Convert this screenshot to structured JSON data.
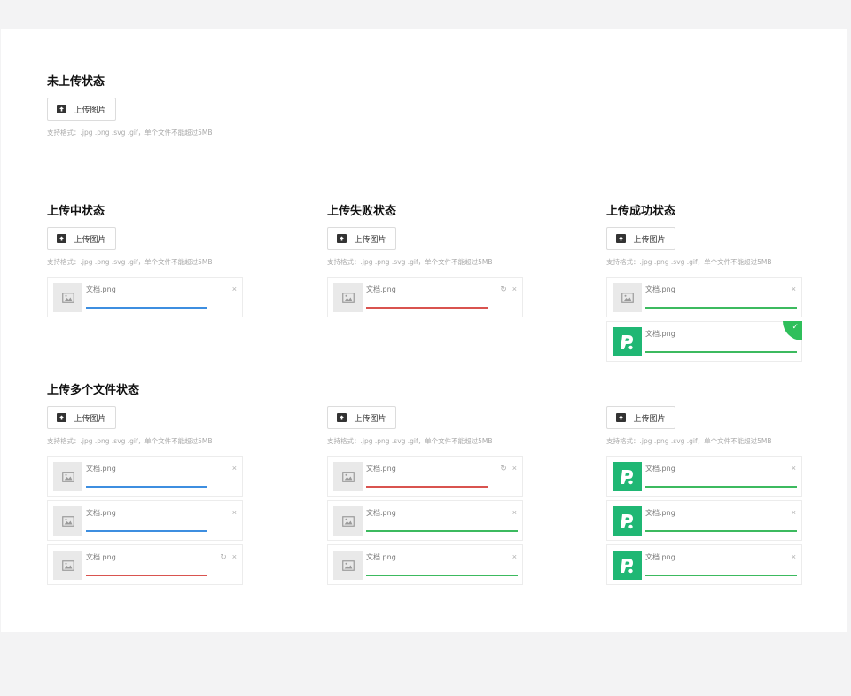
{
  "button_label": "上传图片",
  "hint_text": "支持格式：.jpg .png .svg .gif，单个文件不能超过5MB",
  "colors": {
    "uploading": "#3d8ee0",
    "failed": "#d9534f",
    "success": "#3cba5f",
    "logo_bg": "#1fb774"
  },
  "icons": {
    "upload": "upload-folder-icon",
    "image_placeholder": "image-placeholder-icon",
    "logo": "app-logo-icon",
    "close": "close-icon",
    "retry": "retry-icon",
    "check": "check-icon"
  },
  "glyphs": {
    "close": "×",
    "retry": "↻",
    "check": "✓"
  },
  "sections": {
    "not_uploaded": {
      "title": "未上传状态"
    },
    "uploading": {
      "title": "上传中状态",
      "files": [
        {
          "name": "文档.png",
          "progress": 0.8,
          "state": "uploading",
          "thumb": "placeholder",
          "actions": [
            "close"
          ]
        }
      ]
    },
    "failed": {
      "title": "上传失败状态",
      "files": [
        {
          "name": "文档.png",
          "progress": 0.8,
          "state": "failed",
          "thumb": "placeholder",
          "actions": [
            "retry",
            "close"
          ]
        }
      ]
    },
    "success": {
      "title": "上传成功状态",
      "files": [
        {
          "name": "文档.png",
          "progress": 1.0,
          "state": "success",
          "thumb": "placeholder",
          "actions": [
            "close"
          ]
        },
        {
          "name": "文档.png",
          "progress": 1.0,
          "state": "success",
          "thumb": "logo",
          "actions": [],
          "checked": true
        }
      ]
    },
    "multi": {
      "title": "上传多个文件状态",
      "columns": [
        [
          {
            "name": "文档.png",
            "progress": 0.8,
            "state": "uploading",
            "thumb": "placeholder",
            "actions": [
              "close"
            ]
          },
          {
            "name": "文档.png",
            "progress": 0.8,
            "state": "uploading",
            "thumb": "placeholder",
            "actions": [
              "close"
            ]
          },
          {
            "name": "文档.png",
            "progress": 0.8,
            "state": "failed",
            "thumb": "placeholder",
            "actions": [
              "retry",
              "close"
            ]
          }
        ],
        [
          {
            "name": "文档.png",
            "progress": 0.8,
            "state": "failed",
            "thumb": "placeholder",
            "actions": [
              "retry",
              "close"
            ]
          },
          {
            "name": "文档.png",
            "progress": 1.0,
            "state": "success",
            "thumb": "placeholder",
            "actions": [
              "close"
            ]
          },
          {
            "name": "文档.png",
            "progress": 1.0,
            "state": "success",
            "thumb": "placeholder",
            "actions": [
              "close"
            ]
          }
        ],
        [
          {
            "name": "文档.png",
            "progress": 1.0,
            "state": "success",
            "thumb": "logo",
            "actions": [
              "close"
            ]
          },
          {
            "name": "文档.png",
            "progress": 1.0,
            "state": "success",
            "thumb": "logo",
            "actions": [
              "close"
            ]
          },
          {
            "name": "文档.png",
            "progress": 1.0,
            "state": "success",
            "thumb": "logo",
            "actions": [
              "close"
            ]
          }
        ]
      ]
    }
  }
}
